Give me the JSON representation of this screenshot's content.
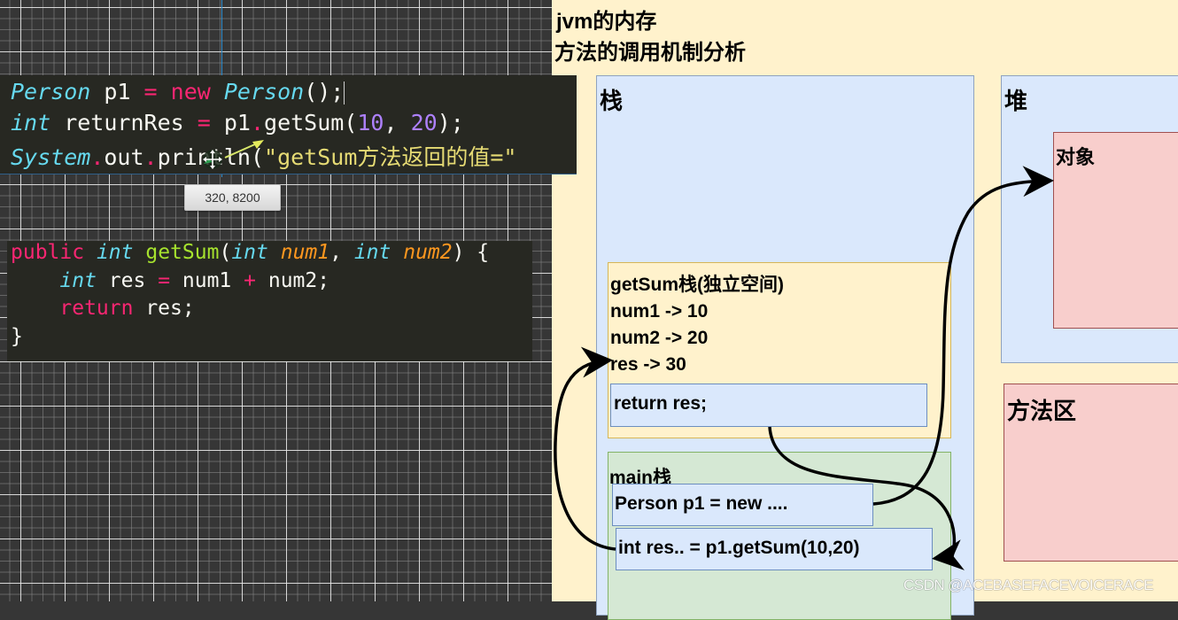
{
  "editor": {
    "code_snippet_1": {
      "lines": [
        [
          {
            "t": "Person",
            "c": "kw-type"
          },
          {
            "t": " p1 "
          },
          {
            "t": "=",
            "c": "kw-red"
          },
          {
            "t": " "
          },
          {
            "t": "new",
            "c": "kw-red"
          },
          {
            "t": " "
          },
          {
            "t": "Person",
            "c": "kw-type"
          },
          {
            "t": "();"
          }
        ],
        [
          {
            "t": "int",
            "c": "kw-type"
          },
          {
            "t": " returnRes "
          },
          {
            "t": "=",
            "c": "kw-red"
          },
          {
            "t": " p1"
          },
          {
            "t": ".",
            "c": "dot"
          },
          {
            "t": "getSum("
          },
          {
            "t": "10",
            "c": "num"
          },
          {
            "t": ", "
          },
          {
            "t": "20",
            "c": "num"
          },
          {
            "t": ");"
          }
        ],
        [
          {
            "t": "System",
            "c": "kw-type"
          },
          {
            "t": ".",
            "c": "dot"
          },
          {
            "t": "out"
          },
          {
            "t": ".",
            "c": "dot"
          },
          {
            "t": "println("
          },
          {
            "t": "\"getSum方法返回的值=\"",
            "c": "str"
          }
        ]
      ]
    },
    "code_snippet_2": {
      "lines": [
        [
          {
            "t": "public",
            "c": "kw-red"
          },
          {
            "t": " "
          },
          {
            "t": "int",
            "c": "kw-type"
          },
          {
            "t": " "
          },
          {
            "t": "getSum",
            "c": "fn"
          },
          {
            "t": "("
          },
          {
            "t": "int",
            "c": "kw-type"
          },
          {
            "t": " "
          },
          {
            "t": "num1",
            "c": "param"
          },
          {
            "t": ", "
          },
          {
            "t": "int",
            "c": "kw-type"
          },
          {
            "t": " "
          },
          {
            "t": "num2",
            "c": "param"
          },
          {
            "t": ") {"
          }
        ],
        [
          {
            "t": "    "
          },
          {
            "t": "int",
            "c": "kw-type"
          },
          {
            "t": " res "
          },
          {
            "t": "=",
            "c": "kw-red"
          },
          {
            "t": " num1 "
          },
          {
            "t": "+",
            "c": "kw-red"
          },
          {
            "t": " num2;"
          }
        ],
        [
          {
            "t": "    "
          },
          {
            "t": "return",
            "c": "kw-red"
          },
          {
            "t": " res;"
          }
        ],
        [
          {
            "t": "}"
          }
        ]
      ]
    },
    "coordinate_tooltip": "320, 8200",
    "cursor_icon": "move-cursor-icon"
  },
  "diagram": {
    "title_line1": "jvm的内存",
    "title_line2": "方法的调用机制分析",
    "stack": {
      "label": "栈",
      "getsum_frame": {
        "lines": [
          "getSum栈(独立空间)",
          "num1 -> 10",
          "num2 -> 20",
          "res -> 30"
        ],
        "return_stmt": "return res;"
      },
      "main_frame": {
        "label": "main栈",
        "person_stmt": "Person p1 = new ....",
        "call_stmt": "int res.. = p1.getSum(10,20)"
      }
    },
    "heap": {
      "label": "堆",
      "object_label": "对象"
    },
    "method_area": {
      "label": "方法区"
    },
    "colors": {
      "background": "#fff2cc",
      "stack_blue": "#dae8fc",
      "object_red": "#f8cecc",
      "main_green": "#d5e8d4",
      "frame_yellow": "#fff2cc"
    }
  },
  "watermark": "CSDN @ACEBASEFACEVOICERACE"
}
